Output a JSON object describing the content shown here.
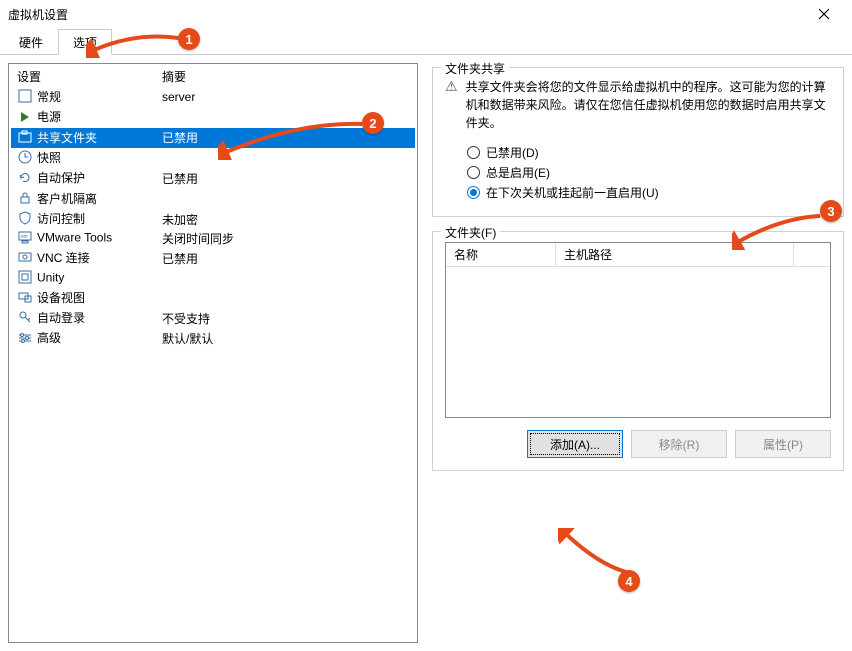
{
  "window": {
    "title": "虚拟机设置"
  },
  "tabs": {
    "hardware": "硬件",
    "options": "选项"
  },
  "table": {
    "header_setting": "设置",
    "header_summary": "摘要",
    "rows": [
      {
        "icon": "box",
        "name": "常规",
        "summary": "server"
      },
      {
        "icon": "play",
        "name": "电源",
        "summary": ""
      },
      {
        "icon": "folder",
        "name": "共享文件夹",
        "summary": "已禁用",
        "selected": true
      },
      {
        "icon": "clock",
        "name": "快照",
        "summary": ""
      },
      {
        "icon": "refresh",
        "name": "自动保护",
        "summary": "已禁用"
      },
      {
        "icon": "lock",
        "name": "客户机隔离",
        "summary": ""
      },
      {
        "icon": "shield",
        "name": "访问控制",
        "summary": "未加密"
      },
      {
        "icon": "vm",
        "name": "VMware Tools",
        "summary": "关闭时间同步"
      },
      {
        "icon": "vnc",
        "name": "VNC 连接",
        "summary": "已禁用"
      },
      {
        "icon": "unity",
        "name": "Unity",
        "summary": ""
      },
      {
        "icon": "device",
        "name": "设备视图",
        "summary": ""
      },
      {
        "icon": "key",
        "name": "自动登录",
        "summary": "不受支持"
      },
      {
        "icon": "adv",
        "name": "高级",
        "summary": "默认/默认"
      }
    ]
  },
  "sharing": {
    "legend": "文件夹共享",
    "warning": "共享文件夹会将您的文件显示给虚拟机中的程序。这可能为您的计算机和数据带来风险。请仅在您信任虚拟机使用您的数据时启用共享文件夹。",
    "opt_disabled": "已禁用(D)",
    "opt_always": "总是启用(E)",
    "opt_until": "在下次关机或挂起前一直启用(U)"
  },
  "folders": {
    "legend": "文件夹(F)",
    "col_name": "名称",
    "col_path": "主机路径",
    "btn_add": "添加(A)...",
    "btn_remove": "移除(R)",
    "btn_props": "属性(P)"
  },
  "badges": {
    "b1": "1",
    "b2": "2",
    "b3": "3",
    "b4": "4"
  }
}
